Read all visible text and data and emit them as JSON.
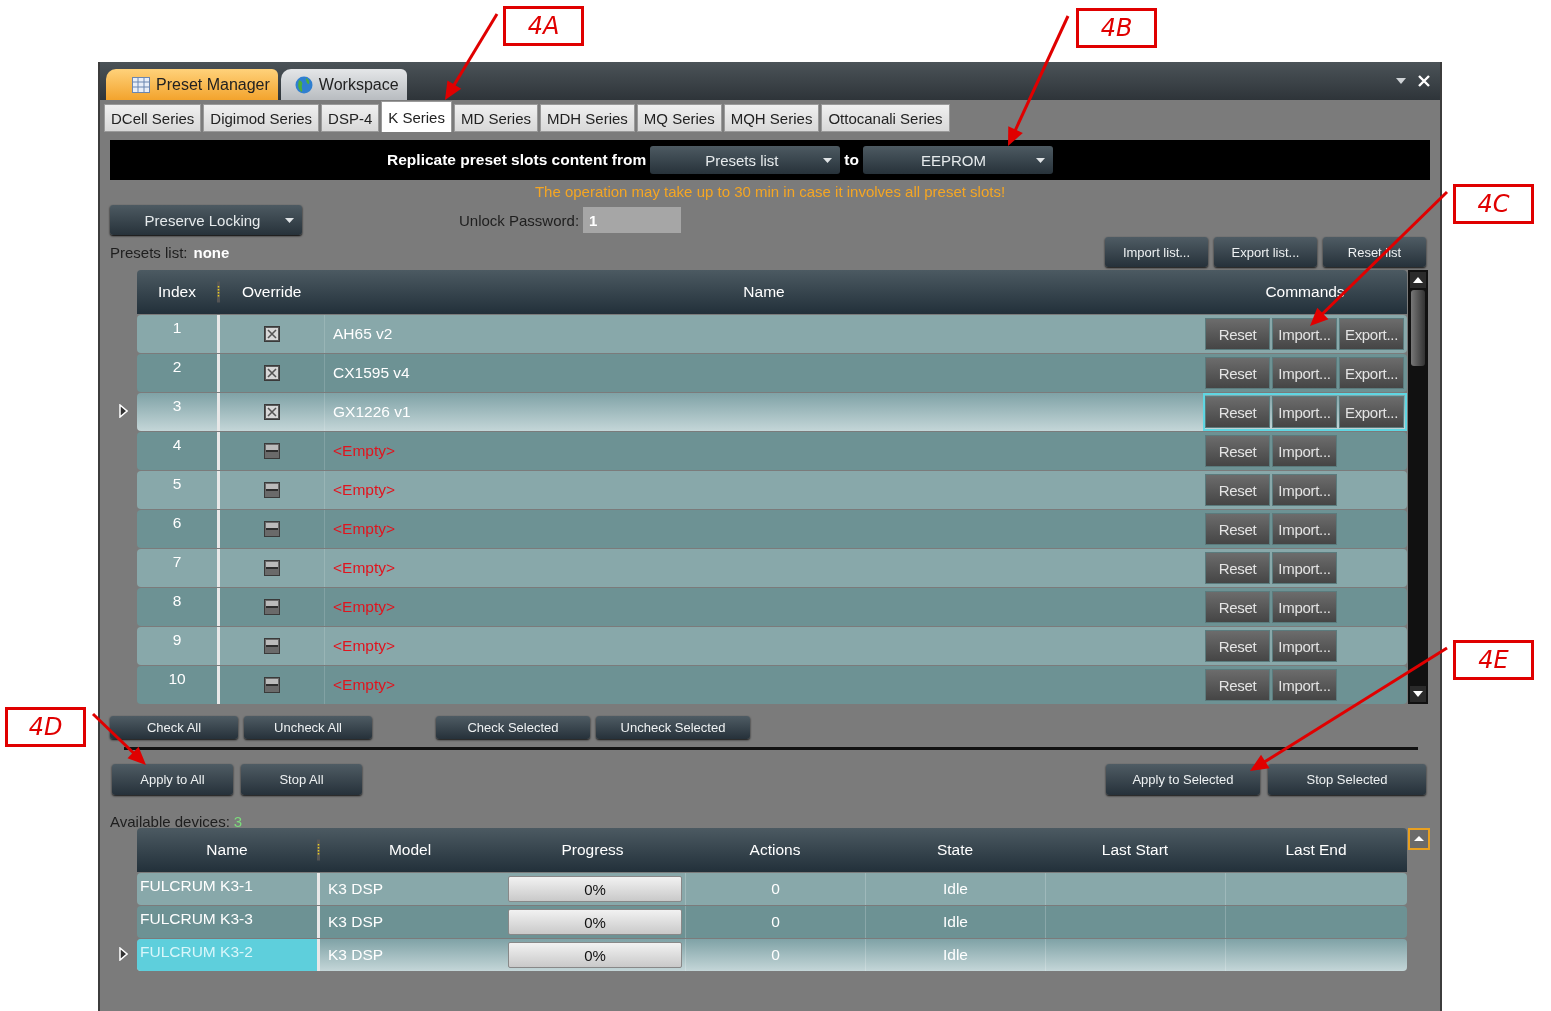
{
  "app_tabs": [
    {
      "label": "Preset Manager",
      "selected": true
    },
    {
      "label": "Workspace",
      "selected": false
    }
  ],
  "series_tabs": [
    {
      "label": "DCell Series",
      "selected": false
    },
    {
      "label": "Digimod Series",
      "selected": false
    },
    {
      "label": "DSP-4",
      "selected": false
    },
    {
      "label": "K Series",
      "selected": true
    },
    {
      "label": "MD Series",
      "selected": false
    },
    {
      "label": "MDH Series",
      "selected": false
    },
    {
      "label": "MQ Series",
      "selected": false
    },
    {
      "label": "MQH Series",
      "selected": false
    },
    {
      "label": "Ottocanali Series",
      "selected": false
    }
  ],
  "replicate": {
    "label": "Replicate preset slots content from",
    "source": "Presets list",
    "connector": "to",
    "target": "EEPROM"
  },
  "warning": "The operation may take up to 30 min in case it involves all preset slots!",
  "locking_dropdown": "Preserve Locking",
  "unlock_password": {
    "label": "Unlock Password:",
    "value": "1"
  },
  "presets_list": {
    "label": "Presets list:",
    "value": "none"
  },
  "list_buttons": [
    "Import list...",
    "Export list...",
    "Reset list"
  ],
  "preset_table": {
    "columns": [
      "Index",
      "Override",
      "Name",
      "Commands"
    ],
    "rows": [
      {
        "index": "1",
        "checked": true,
        "name": "AH65 v2",
        "empty": false,
        "selected": false,
        "commands": [
          "Reset",
          "Import...",
          "Export..."
        ]
      },
      {
        "index": "2",
        "checked": true,
        "name": "CX1595 v4",
        "empty": false,
        "selected": false,
        "commands": [
          "Reset",
          "Import...",
          "Export..."
        ]
      },
      {
        "index": "3",
        "checked": true,
        "name": "GX1226 v1",
        "empty": false,
        "selected": true,
        "commands": [
          "Reset",
          "Import...",
          "Export..."
        ]
      },
      {
        "index": "4",
        "checked": false,
        "name": "<Empty>",
        "empty": true,
        "selected": false,
        "commands": [
          "Reset",
          "Import..."
        ]
      },
      {
        "index": "5",
        "checked": false,
        "name": "<Empty>",
        "empty": true,
        "selected": false,
        "commands": [
          "Reset",
          "Import..."
        ]
      },
      {
        "index": "6",
        "checked": false,
        "name": "<Empty>",
        "empty": true,
        "selected": false,
        "commands": [
          "Reset",
          "Import..."
        ]
      },
      {
        "index": "7",
        "checked": false,
        "name": "<Empty>",
        "empty": true,
        "selected": false,
        "commands": [
          "Reset",
          "Import..."
        ]
      },
      {
        "index": "8",
        "checked": false,
        "name": "<Empty>",
        "empty": true,
        "selected": false,
        "commands": [
          "Reset",
          "Import..."
        ]
      },
      {
        "index": "9",
        "checked": false,
        "name": "<Empty>",
        "empty": true,
        "selected": false,
        "commands": [
          "Reset",
          "Import..."
        ]
      },
      {
        "index": "10",
        "checked": false,
        "name": "<Empty>",
        "empty": true,
        "selected": false,
        "commands": [
          "Reset",
          "Import..."
        ]
      }
    ]
  },
  "check_buttons": [
    "Check All",
    "Uncheck All",
    "Check Selected",
    "Uncheck Selected"
  ],
  "apply_buttons": [
    "Apply to All",
    "Stop All",
    "Apply to Selected",
    "Stop Selected"
  ],
  "available_devices": {
    "label": "Available devices:",
    "count": "3"
  },
  "device_table": {
    "columns": [
      "Name",
      "Model",
      "Progress",
      "Actions",
      "State",
      "Last Start",
      "Last End"
    ],
    "rows": [
      {
        "name": "FULCRUM K3-1",
        "model": "K3 DSP",
        "progress": "0%",
        "level": 0,
        "actions": "0",
        "state": "Idle",
        "selected": false
      },
      {
        "name": "FULCRUM K3-3",
        "model": "K3 DSP",
        "progress": "0%",
        "level": 0,
        "actions": "0",
        "state": "Idle",
        "selected": false
      },
      {
        "name": "FULCRUM K3-2",
        "model": "K3 DSP",
        "progress": "0%",
        "level": 0,
        "actions": "0",
        "state": "Idle",
        "selected": true
      }
    ]
  },
  "callouts": [
    {
      "label": "4A"
    },
    {
      "label": "4B"
    },
    {
      "label": "4C"
    },
    {
      "label": "4D"
    },
    {
      "label": "4E"
    }
  ]
}
